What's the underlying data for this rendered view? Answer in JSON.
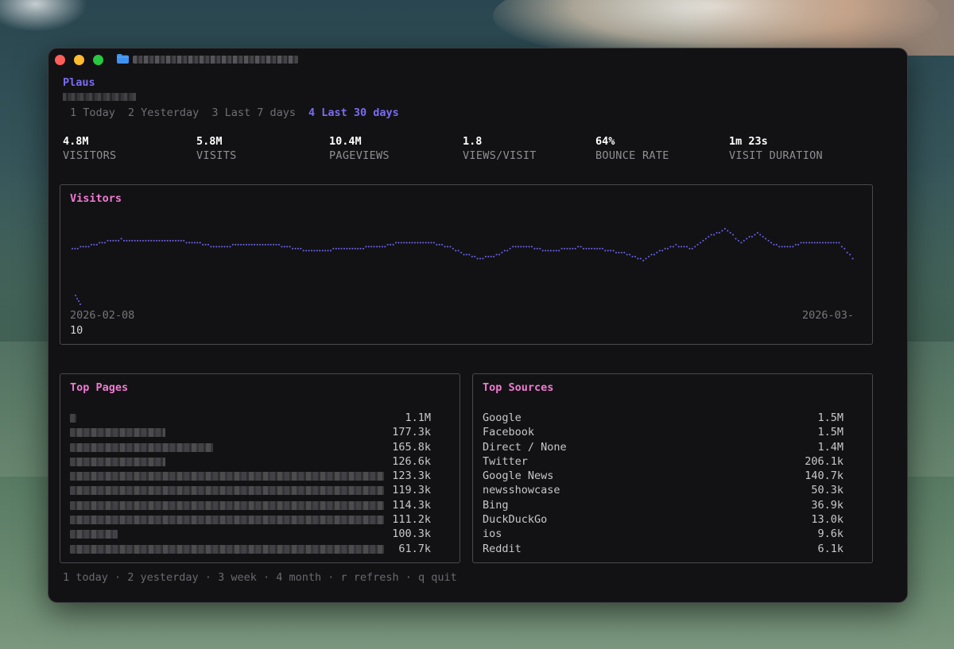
{
  "app": {
    "name": "Plaus"
  },
  "tabs": [
    {
      "label": "1 Today"
    },
    {
      "label": "2 Yesterday"
    },
    {
      "label": "3 Last 7 days"
    },
    {
      "label": "4 Last 30 days",
      "active": true
    }
  ],
  "stats": [
    {
      "value": "4.8M",
      "label": "VISITORS"
    },
    {
      "value": "5.8M",
      "label": "VISITS"
    },
    {
      "value": "10.4M",
      "label": "PAGEVIEWS"
    },
    {
      "value": "1.8",
      "label": "VIEWS/VISIT"
    },
    {
      "value": "64%",
      "label": "BOUNCE RATE"
    },
    {
      "value": "1m 23s",
      "label": "VISIT DURATION"
    }
  ],
  "visitors_panel": {
    "title": "Visitors",
    "start_label": "2026-02-08",
    "end_label": "2026-03-",
    "end_label_cont": "10"
  },
  "top_pages": {
    "title": "Top Pages",
    "rows": [
      {
        "value": "1.1M"
      },
      {
        "value": "177.3k"
      },
      {
        "value": "165.8k"
      },
      {
        "value": "126.6k"
      },
      {
        "value": "123.3k"
      },
      {
        "value": "119.3k"
      },
      {
        "value": "114.3k"
      },
      {
        "value": "111.2k"
      },
      {
        "value": "100.3k"
      },
      {
        "value": "61.7k"
      }
    ]
  },
  "top_sources": {
    "title": "Top Sources",
    "rows": [
      {
        "name": "Google",
        "value": "1.5M"
      },
      {
        "name": "Facebook",
        "value": "1.5M"
      },
      {
        "name": "Direct / None",
        "value": "1.4M"
      },
      {
        "name": "Twitter",
        "value": "206.1k"
      },
      {
        "name": "Google News",
        "value": "140.7k"
      },
      {
        "name": "newsshowcase",
        "value": "50.3k"
      },
      {
        "name": "Bing",
        "value": "36.9k"
      },
      {
        "name": "DuckDuckGo",
        "value": "13.0k"
      },
      {
        "name": "ios",
        "value": "9.6k"
      },
      {
        "name": "Reddit",
        "value": "6.1k"
      }
    ]
  },
  "footer": {
    "text": "1 today · 2 yesterday · 3 week · 4 month · r refresh · q quit"
  },
  "colors": {
    "accent": "#7a6cf0",
    "panel_title": "#f07ad2",
    "chart_dots": "#6c63e8"
  },
  "chart_data": {
    "type": "line",
    "x_start": "2026-02-08",
    "x_end": "2026-03-10",
    "series": [
      {
        "values": [
          0.68,
          0.7,
          0.74,
          0.76,
          0.75,
          0.75,
          0.75,
          0.74,
          0.72,
          0.69,
          0.71,
          0.72,
          0.72,
          0.7,
          0.67,
          0.66,
          0.67,
          0.67,
          0.69,
          0.7,
          0.73,
          0.73,
          0.73,
          0.7,
          0.63,
          0.59,
          0.62,
          0.69,
          0.7,
          0.66,
          0.67,
          0.69,
          0.68,
          0.66,
          0.63,
          0.58,
          0.66,
          0.71,
          0.68,
          0.79,
          0.85,
          0.74,
          0.82,
          0.71,
          0.69,
          0.74,
          0.74,
          0.73,
          0.56
        ]
      }
    ],
    "ylim": [
      0,
      1
    ]
  }
}
